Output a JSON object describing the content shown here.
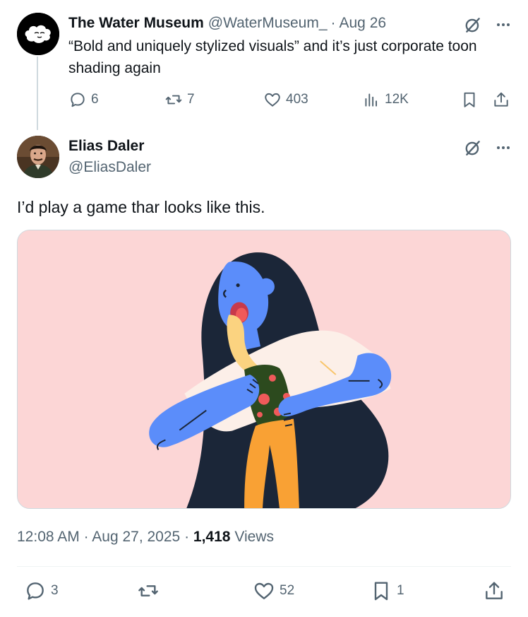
{
  "parent_tweet": {
    "display_name": "The Water Museum",
    "handle": "@WaterMuseum_",
    "separator": "·",
    "date": "Aug 26",
    "text": "“Bold and uniquely stylized visuals” and it’s just corporate toon shading again",
    "stats": {
      "replies": "6",
      "reposts": "7",
      "likes": "403",
      "views": "12K"
    }
  },
  "main_tweet": {
    "display_name": "Elias Daler",
    "handle": "@EliasDaler",
    "text": "I’d play a game thar looks like this.",
    "time": "12:08 AM",
    "separator": "·",
    "date": "Aug 27, 2025",
    "views_count": "1,418",
    "views_label": "Views",
    "stats": {
      "replies": "3",
      "likes": "52",
      "bookmarks": "1"
    }
  },
  "icons": {
    "reply": "reply-bubble-icon",
    "repost": "repost-icon",
    "like": "heart-icon",
    "views": "views-bars-icon",
    "bookmark": "bookmark-icon",
    "share": "share-upload-icon",
    "grok": "grok-icon",
    "more": "more-dots-icon"
  },
  "colors": {
    "text_primary": "#0f1419",
    "text_secondary": "#536471",
    "media_background": "#fcd6d6",
    "illustration_blue": "#5b8dfa",
    "illustration_hair": "#1b2638",
    "illustration_orange": "#f9a134",
    "illustration_red": "#f05a5a"
  }
}
